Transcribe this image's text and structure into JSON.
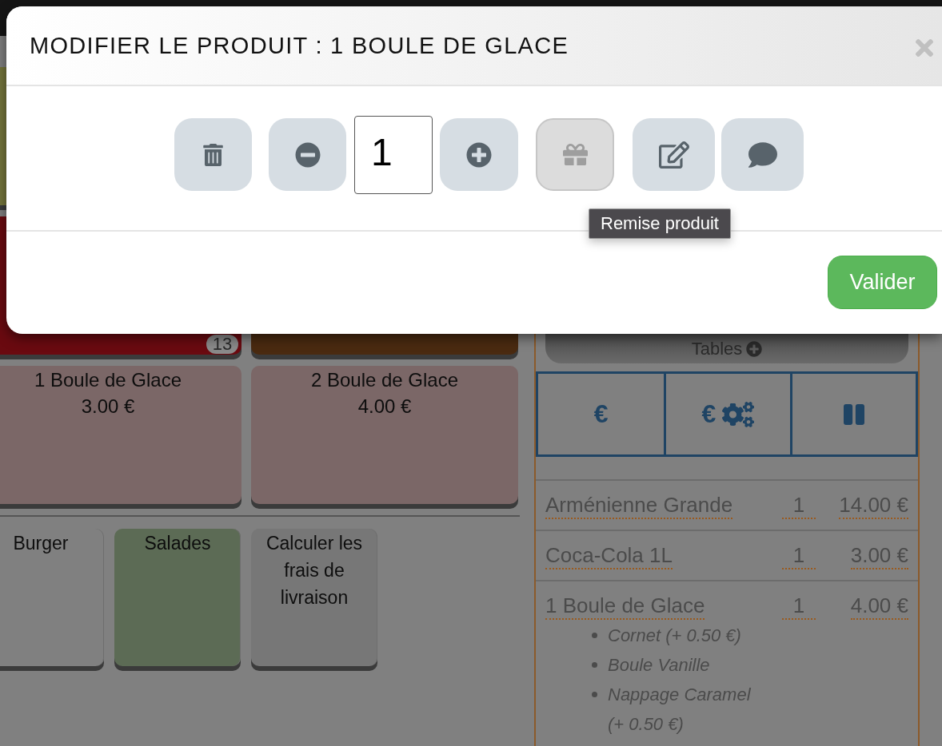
{
  "modal": {
    "title": "MODIFIER LE PRODUIT : 1 BOULE DE GLACE",
    "actions": [
      {
        "kind": "delete",
        "disabled": false
      },
      {
        "kind": "decrement",
        "disabled": false
      },
      {
        "kind": "quantity",
        "value": "1",
        "disabled": false
      },
      {
        "kind": "increment",
        "disabled": false
      },
      {
        "kind": "discount",
        "disabled": true
      },
      {
        "kind": "edit",
        "disabled": false
      },
      {
        "kind": "comment",
        "disabled": false
      }
    ],
    "tooltip": "Remise produit",
    "confirm_button": "Valider"
  },
  "product_grid": [
    [
      {
        "color": "#75763c"
      }
    ],
    [
      {
        "color": "#6a0a10",
        "badge": "13"
      },
      {
        "color": "#4a2a10"
      }
    ],
    [
      {
        "name": "1 Boule de Glace",
        "price": "3.00 €",
        "color": "#7b6767"
      },
      {
        "name": "2 Boule de Glace",
        "price": "4.00 €",
        "color": "#7b6767"
      }
    ]
  ],
  "categories": [
    {
      "label": "Burger",
      "color": "#808080"
    },
    {
      "label": "Salades",
      "color": "#5c6b55"
    },
    {
      "label": "Calculer les frais de livraison",
      "color": "#777777"
    }
  ],
  "order_panel": {
    "tables_button": "Tables",
    "payment_buttons": [
      {
        "kind": "cash",
        "label": "€"
      },
      {
        "kind": "cash_settings",
        "label": "€"
      },
      {
        "kind": "pause"
      }
    ],
    "lines": [
      {
        "name": "Arménienne Grande",
        "qty": "1",
        "price": "14.00 €"
      },
      {
        "name": "Coca-Cola 1L",
        "qty": "1",
        "price": "3.00 €"
      },
      {
        "name": "1 Boule de Glace",
        "qty": "1",
        "price": "4.00 €",
        "options": [
          "Cornet (+ 0.50 €)",
          "Boule Vanille",
          "Nappage Caramel (+ 0.50 €)"
        ]
      }
    ]
  }
}
